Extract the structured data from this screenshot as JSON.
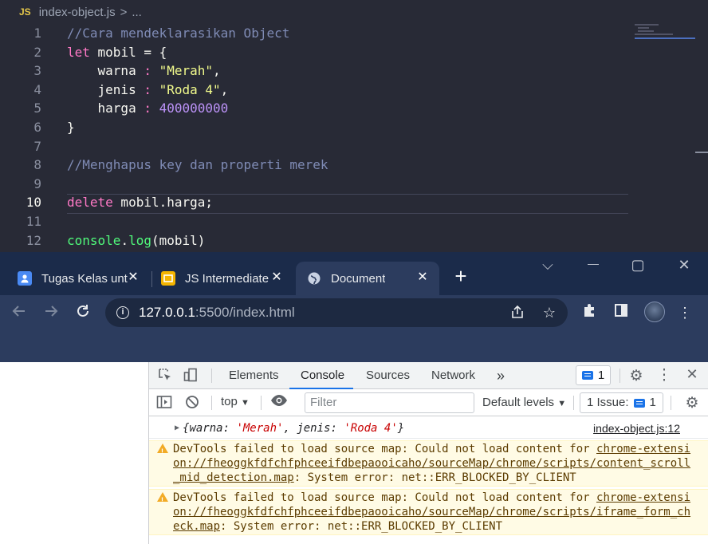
{
  "editor": {
    "breadcrumb": {
      "lang_badge": "JS",
      "file": "index-object.js",
      "sep": ">",
      "ellipsis": "..."
    },
    "active_line": 10,
    "lines": [
      {
        "n": "1",
        "tokens": [
          {
            "t": "//Cara mendeklarasikan Object",
            "c": "comment"
          }
        ]
      },
      {
        "n": "2",
        "tokens": [
          {
            "t": "let",
            "c": "kw"
          },
          {
            "t": " mobil = {",
            "c": "var"
          }
        ]
      },
      {
        "n": "3",
        "tokens": [
          {
            "t": "    warna ",
            "c": "var"
          },
          {
            "t": ":",
            "c": "kw"
          },
          {
            "t": " ",
            "c": "var"
          },
          {
            "t": "\"Merah\"",
            "c": "str"
          },
          {
            "t": ",",
            "c": "var"
          }
        ]
      },
      {
        "n": "4",
        "tokens": [
          {
            "t": "    jenis ",
            "c": "var"
          },
          {
            "t": ":",
            "c": "kw"
          },
          {
            "t": " ",
            "c": "var"
          },
          {
            "t": "\"Roda 4\"",
            "c": "str"
          },
          {
            "t": ",",
            "c": "var"
          }
        ]
      },
      {
        "n": "5",
        "tokens": [
          {
            "t": "    harga ",
            "c": "var"
          },
          {
            "t": ":",
            "c": "kw"
          },
          {
            "t": " ",
            "c": "var"
          },
          {
            "t": "400000000",
            "c": "num"
          }
        ]
      },
      {
        "n": "6",
        "tokens": [
          {
            "t": "}",
            "c": "var"
          }
        ]
      },
      {
        "n": "7",
        "tokens": []
      },
      {
        "n": "8",
        "tokens": [
          {
            "t": "//Menghapus key dan properti merek",
            "c": "comment"
          }
        ]
      },
      {
        "n": "9",
        "tokens": []
      },
      {
        "n": "10",
        "tokens": [
          {
            "t": "delete",
            "c": "kw"
          },
          {
            "t": " mobil.harga;",
            "c": "var"
          }
        ]
      },
      {
        "n": "11",
        "tokens": []
      },
      {
        "n": "12",
        "tokens": [
          {
            "t": "console",
            "c": "fn"
          },
          {
            "t": ".",
            "c": "var"
          },
          {
            "t": "log",
            "c": "fn"
          },
          {
            "t": "(mobil)",
            "c": "var"
          }
        ]
      }
    ],
    "colors": {
      "background": "#282a36",
      "comment": "#7f8bb5",
      "keyword": "#ff79c6",
      "string": "#f1fa8c",
      "number": "#bd93f9",
      "function": "#50fa7b"
    }
  },
  "browser": {
    "tabs": [
      {
        "title": "Tugas Kelas unt",
        "favicon": "user-icon",
        "close": "✕"
      },
      {
        "title": "JS Intermediate",
        "favicon": "slides-icon",
        "close": "✕"
      },
      {
        "title": "Document",
        "favicon": "globe-icon",
        "close": "✕"
      }
    ],
    "new_tab": "+",
    "window_controls": {
      "search_tabs": "⌵",
      "minimize": "—",
      "maximize": "▢",
      "close": "✕"
    },
    "url_host": "127.0.0.1",
    "url_rest": ":5500/index.html",
    "colors": {
      "tabstrip": "#1b2b4a",
      "toolbar": "#2c3c5e"
    }
  },
  "devtools": {
    "tabs": [
      "Elements",
      "Console",
      "Sources",
      "Network"
    ],
    "selected_tab": "Console",
    "more_tabs": "»",
    "message_count": "1",
    "context": "top",
    "filter_placeholder": "Filter",
    "levels": "Default levels",
    "issues_label": "1 Issue:",
    "issues_count": "1",
    "log_entry": {
      "open": "{",
      "k1": "warna:",
      "v1": "'Merah'",
      "k2": "jenis:",
      "v2": "'Roda 4'",
      "close": "}",
      "source": "index-object.js:12"
    },
    "warnings": [
      {
        "prefix": "DevTools failed to load source map: Could not load content for ",
        "link": "chrome-extension://fheoggkfdfchfphceeifdbepaooicaho/sourceMap/chrome/scripts/content_scroll_mid_detection.map",
        "suffix": ": System error: net::ERR_BLOCKED_BY_CLIENT"
      },
      {
        "prefix": "DevTools failed to load source map: Could not load content for ",
        "link": "chrome-extension://fheoggkfdfchfphceeifdbepaooicaho/sourceMap/chrome/scripts/iframe_form_check.map",
        "suffix": ": System error: net::ERR_BLOCKED_BY_CLIENT"
      }
    ]
  }
}
